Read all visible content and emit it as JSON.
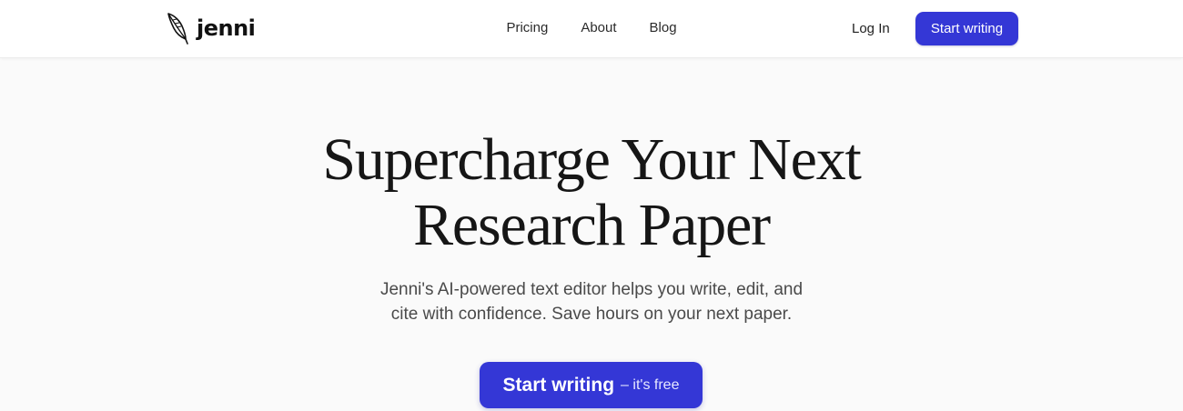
{
  "brand": {
    "name": "jenni",
    "icon": "quill-feather-icon"
  },
  "nav": {
    "links": [
      "Pricing",
      "About",
      "Blog"
    ],
    "login_label": "Log In",
    "cta_label": "Start writing"
  },
  "hero": {
    "title_line1": "Supercharge Your Next",
    "title_line2": "Research Paper",
    "subtitle_line1": "Jenni's AI-powered text editor helps you write, edit, and",
    "subtitle_line2": "cite with confidence. Save hours on your next paper.",
    "cta_main": "Start writing",
    "cta_sub": "– it's free"
  },
  "colors": {
    "accent": "#3437d6",
    "page_background": "#fafafa",
    "nav_background": "#ffffff",
    "heading_text": "#161616",
    "body_text": "#4a4a4a"
  }
}
